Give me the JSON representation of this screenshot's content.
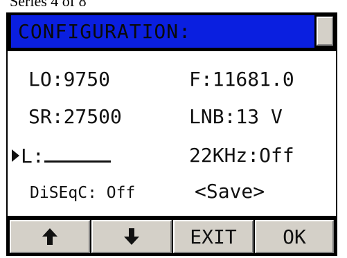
{
  "caption": {
    "text": "Series 4 of 8"
  },
  "screen": {
    "title": "CONFIGURATION:",
    "fields": {
      "lo": "LO:9750",
      "freq": "F:11681.0",
      "sr": "SR:27500",
      "lnb": "LNB:13 V",
      "l_label": "L:",
      "khz": "22KHz:Off",
      "diseqc": "DiSEqC: Off",
      "save": "<Save>"
    }
  },
  "buttons": {
    "up_icon": "arrow-up-icon",
    "down_icon": "arrow-down-icon",
    "exit": "EXIT",
    "ok": "OK"
  },
  "colors": {
    "title_bar": "#0a1fe0",
    "frame": "#000000",
    "button_face": "#d4d0c8",
    "panel": "#ffffff"
  }
}
